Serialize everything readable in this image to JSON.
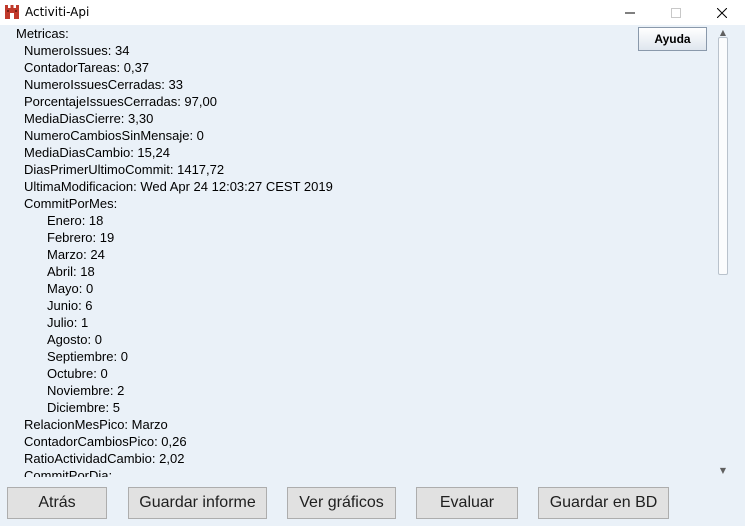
{
  "window": {
    "title": "Activiti-Api"
  },
  "help_button": "Ayuda",
  "metrics": [
    {
      "text": "Metricas:",
      "level": 0
    },
    {
      "text": "NumeroIssues: 34",
      "level": 1
    },
    {
      "text": "ContadorTareas: 0,37",
      "level": 1
    },
    {
      "text": "NumeroIssuesCerradas: 33",
      "level": 1
    },
    {
      "text": "PorcentajeIssuesCerradas: 97,00",
      "level": 1
    },
    {
      "text": "MediaDiasCierre: 3,30",
      "level": 1
    },
    {
      "text": "NumeroCambiosSinMensaje: 0",
      "level": 1
    },
    {
      "text": "MediaDiasCambio: 15,24",
      "level": 1
    },
    {
      "text": "DiasPrimerUltimoCommit: 1417,72",
      "level": 1
    },
    {
      "text": "UltimaModificacion: Wed Apr 24 12:03:27 CEST 2019",
      "level": 1
    },
    {
      "text": "CommitPorMes:",
      "level": 1
    },
    {
      "text": "Enero: 18",
      "level": 2
    },
    {
      "text": "Febrero: 19",
      "level": 2
    },
    {
      "text": "Marzo: 24",
      "level": 2
    },
    {
      "text": "Abril: 18",
      "level": 2
    },
    {
      "text": "Mayo: 0",
      "level": 2
    },
    {
      "text": "Junio: 6",
      "level": 2
    },
    {
      "text": "Julio: 1",
      "level": 2
    },
    {
      "text": "Agosto: 0",
      "level": 2
    },
    {
      "text": "Septiembre: 0",
      "level": 2
    },
    {
      "text": "Octubre: 0",
      "level": 2
    },
    {
      "text": "Noviembre: 2",
      "level": 2
    },
    {
      "text": "Diciembre: 5",
      "level": 2
    },
    {
      "text": "RelacionMesPico: Marzo",
      "level": 1
    },
    {
      "text": "ContadorCambiosPico: 0,26",
      "level": 1
    },
    {
      "text": "RatioActividadCambio: 2,02",
      "level": 1
    },
    {
      "text": "CommitPorDia:",
      "level": 1
    }
  ],
  "buttons": {
    "back": "Atrás",
    "save_report": "Guardar informe",
    "view_charts": "Ver gráficos",
    "evaluate": "Evaluar",
    "save_db": "Guardar en BD"
  },
  "icons": {
    "app": "castle-icon",
    "minimize": "minimize-icon",
    "maximize": "maximize-icon",
    "close": "close-icon"
  }
}
